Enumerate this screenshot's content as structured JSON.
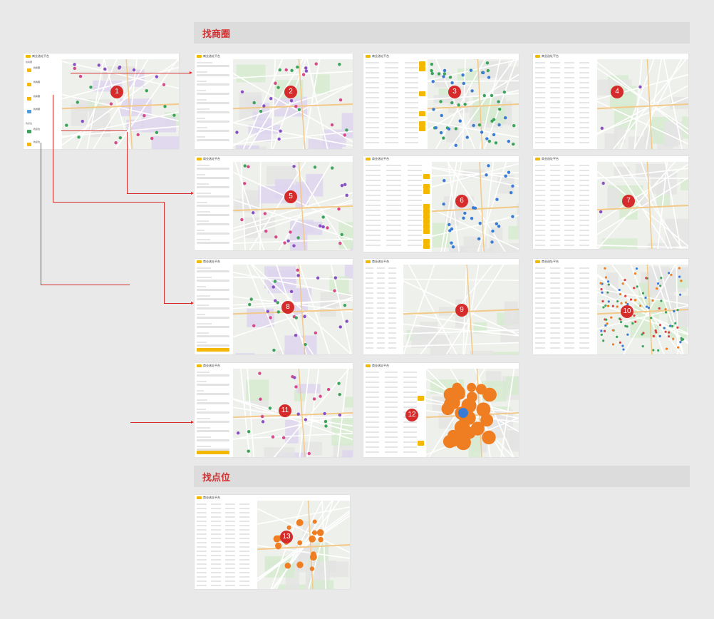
{
  "sections": [
    {
      "title": "找商圈"
    },
    {
      "title": "找点位"
    }
  ],
  "app": {
    "name": "商业选址平台"
  },
  "first": {
    "group1": "找商圈",
    "group2": "找点位",
    "cards": [
      {
        "title": "找商圈"
      },
      {
        "title": "找商圈"
      },
      {
        "title": "找商圈"
      },
      {
        "title": "找商圈"
      },
      {
        "title": "找点位"
      },
      {
        "title": "找点位"
      }
    ]
  },
  "shots": [
    {
      "label": "1"
    },
    {
      "label": "2"
    },
    {
      "label": "3"
    },
    {
      "label": "4"
    },
    {
      "label": "5"
    },
    {
      "label": "6"
    },
    {
      "label": "7"
    },
    {
      "label": "8"
    },
    {
      "label": "9"
    },
    {
      "label": "10"
    },
    {
      "label": "11"
    },
    {
      "label": "12"
    },
    {
      "label": "13"
    }
  ],
  "colors": {
    "brand": "#f5b800",
    "badge": "#d62b2b",
    "section_title": "#d32f2f",
    "pin_blue": "#3a7bd5",
    "pin_green": "#3aa55a",
    "pin_purple": "#8a4fc4",
    "pin_orange": "#ef7d22"
  }
}
